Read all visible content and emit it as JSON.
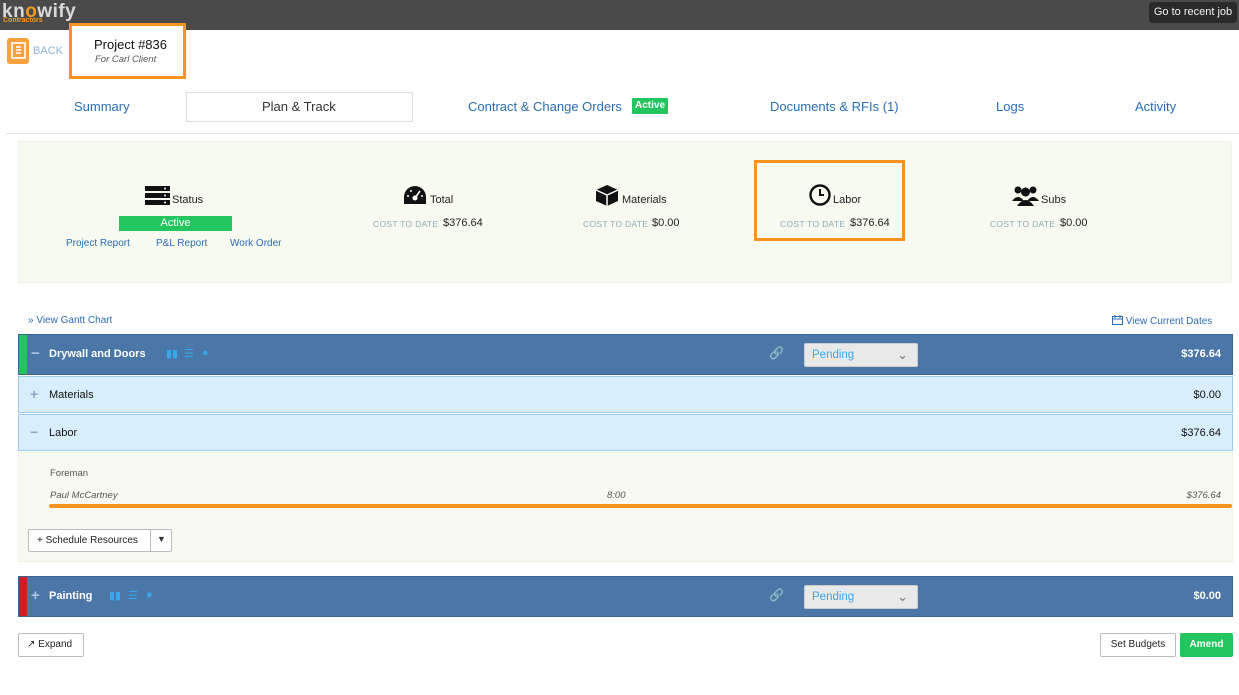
{
  "brand": {
    "logo_prefix": "kn",
    "logo_o": "o",
    "logo_suffix": "wify",
    "logo_sub": "Contractors"
  },
  "header": {
    "recent_job_label": "Go to recent job",
    "back_label": "BACK"
  },
  "project": {
    "title": "Project #836",
    "client": "For Carl Client"
  },
  "tabs": [
    {
      "label": "Summary"
    },
    {
      "label": "Plan & Track"
    },
    {
      "label": "Contract & Change Orders",
      "badge": "Active"
    },
    {
      "label": "Documents & RFIs (1)"
    },
    {
      "label": "Logs"
    },
    {
      "label": "Activity"
    }
  ],
  "summary": {
    "status": {
      "label": "Status",
      "value": "Active",
      "badge_color": "#22c55e"
    },
    "links": [
      "Project Report",
      "P&L Report",
      "Work Order"
    ],
    "cost_caption": "COST TO DATE",
    "metrics": [
      {
        "label": "Total",
        "icon": "dashboard-icon",
        "cost": "$376.64"
      },
      {
        "label": "Materials",
        "icon": "box-icon",
        "cost": "$0.00"
      },
      {
        "label": "Labor",
        "icon": "clock-icon",
        "cost": "$376.64"
      },
      {
        "label": "Subs",
        "icon": "users-icon",
        "cost": "$0.00"
      }
    ]
  },
  "timeline": {
    "gantt_link": "» View Gantt Chart",
    "dates_link": "View Current Dates"
  },
  "groups": [
    {
      "name": "Drywall and Doors",
      "sign": "−",
      "status": "Pending",
      "amount": "$376.64",
      "stripe_color": "#22c55e",
      "subsections": [
        {
          "sign": "+",
          "name": "Materials",
          "amount": "$0.00"
        },
        {
          "sign": "−",
          "name": "Labor",
          "amount": "$376.64"
        }
      ],
      "labor_detail": {
        "role": "Foreman",
        "worker": "Paul McCartney",
        "hours": "8:00",
        "amount": "$376.64"
      },
      "schedule_button": "+ Schedule Resources"
    },
    {
      "name": "Painting",
      "sign": "+",
      "status": "Pending",
      "amount": "$0.00",
      "stripe_color": "#cc1f1f"
    }
  ],
  "footer": {
    "expand_label": "Expand",
    "set_budgets_label": "Set Budgets",
    "amend_label": "Amend"
  },
  "colors": {
    "accent": "#f7941e",
    "link": "#2a6db5",
    "group_bar": "#4a76a8",
    "success": "#22c55e"
  }
}
